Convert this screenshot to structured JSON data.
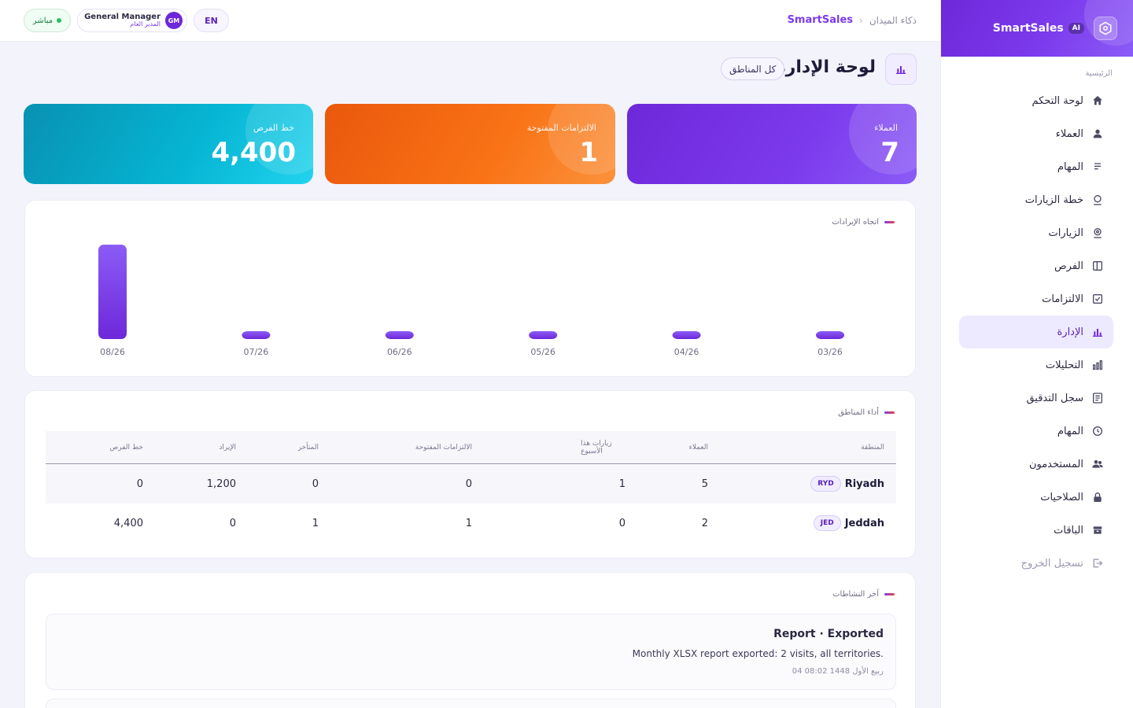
{
  "brand": {
    "name": "SmartSales",
    "badge": "AI"
  },
  "sidebar": {
    "section": "الرئيسية",
    "items": [
      {
        "label": "لوحة التحكم",
        "icon": "home-icon"
      },
      {
        "label": "العملاء",
        "icon": "user-icon"
      },
      {
        "label": "المهام",
        "icon": "tasks-icon"
      },
      {
        "label": "خطة الزيارات",
        "icon": "map-pin-icon"
      },
      {
        "label": "الزيارات",
        "icon": "visit-pin-icon"
      },
      {
        "label": "الفرص",
        "icon": "columns-icon"
      },
      {
        "label": "الالتزامات",
        "icon": "check-square-icon"
      },
      {
        "label": "الإدارة",
        "icon": "bar-chart-icon",
        "active": true
      },
      {
        "label": "التحليلات",
        "icon": "analytics-icon"
      },
      {
        "label": "سجل التدقيق",
        "icon": "document-icon"
      },
      {
        "label": "المهام",
        "icon": "clock-icon"
      },
      {
        "label": "المستخدمون",
        "icon": "users-icon"
      },
      {
        "label": "الصلاحيات",
        "icon": "lock-icon"
      },
      {
        "label": "الباقات",
        "icon": "package-icon"
      },
      {
        "label": "تسجيل الخروج",
        "icon": "logout-icon"
      }
    ]
  },
  "topbar": {
    "breadcrumb": {
      "app": "SmartSales",
      "sep": "›",
      "section": "ذكاء الميدان"
    },
    "live": "مباشر",
    "user": {
      "role_en": "General Manager",
      "role_ar": "المدير العام",
      "initials": "GM"
    },
    "language": "EN"
  },
  "page": {
    "title": "لوحة الإدارة",
    "region_filter": "كل المناطق"
  },
  "kpis": {
    "clients": {
      "label": "العملاء",
      "value": "7"
    },
    "commitments": {
      "label": "الالتزامات المفتوحة",
      "value": "1"
    },
    "pipeline": {
      "label": "خط الفرص",
      "value": "4,400"
    }
  },
  "revenue_card": {
    "title": "اتجاه الإيرادات"
  },
  "chart_data": {
    "type": "bar",
    "categories": [
      "08/26",
      "07/26",
      "06/26",
      "05/26",
      "04/26",
      "03/26"
    ],
    "values": [
      1200,
      0,
      0,
      0,
      0,
      0
    ],
    "title": "اتجاه الإيرادات",
    "xlabel": "",
    "ylabel": "",
    "ylim": [
      0,
      1200
    ],
    "grid": false,
    "bar_color": "#7c3aed"
  },
  "regions_card": {
    "title": "أداء المناطق",
    "headers": {
      "region": "المنطقة",
      "clients": "العملاء",
      "visits": "زيارات هذا الأسبوع",
      "commitments": "الالتزامات المفتوحة",
      "late": "المتأخر",
      "revenue": "الإيراد",
      "pipeline": "خط الفرص"
    },
    "rows": [
      {
        "name": "Riyadh",
        "code": "RYD",
        "clients": "5",
        "visits": "1",
        "commitments": "0",
        "late": "0",
        "revenue": "1,200",
        "pipeline": "0"
      },
      {
        "name": "Jeddah",
        "code": "JED",
        "clients": "2",
        "visits": "0",
        "commitments": "1",
        "late": "1",
        "revenue": "0",
        "pipeline": "4,400"
      }
    ]
  },
  "activity_card": {
    "title": "آخر النشاطات",
    "items": [
      {
        "title": "Report · Exported",
        "description": "Monthly XLSX report exported: 2 visits, all territories.",
        "time": "04 ربيع الأول 1448 08:02"
      }
    ]
  },
  "colors": {
    "accent": "#7c3aed",
    "clients_card": "#7c3aed",
    "commitments_card": "#f97316",
    "pipeline_card": "#06b6d4",
    "live": "#22c55e"
  }
}
